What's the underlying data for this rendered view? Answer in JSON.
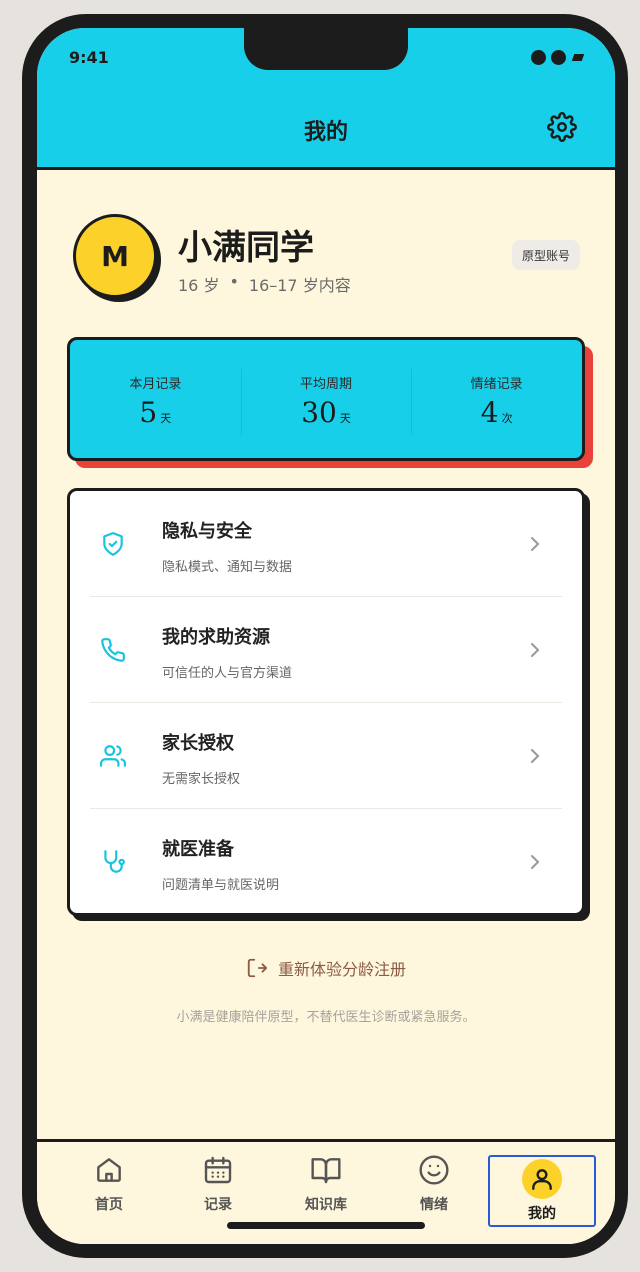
{
  "status": {
    "time": "9:41"
  },
  "header": {
    "title": "我的",
    "settings_icon": "gear-icon"
  },
  "profile": {
    "avatar_initial": "M",
    "name": "小满同学",
    "age": "16 岁",
    "separator": "•",
    "content_range": "16–17 岁内容",
    "badge": "原型账号"
  },
  "stats": [
    {
      "label": "本月记录",
      "value": "5",
      "unit": "天"
    },
    {
      "label": "平均周期",
      "value": "30",
      "unit": "天"
    },
    {
      "label": "情绪记录",
      "value": "4",
      "unit": "次"
    }
  ],
  "menu": [
    {
      "title": "隐私与安全",
      "subtitle": "隐私模式、通知与数据",
      "icon": "shield-check-icon"
    },
    {
      "title": "我的求助资源",
      "subtitle": "可信任的人与官方渠道",
      "icon": "phone-icon"
    },
    {
      "title": "家长授权",
      "subtitle": "无需家长授权",
      "icon": "users-icon"
    },
    {
      "title": "就医准备",
      "subtitle": "问题清单与就医说明",
      "icon": "stethoscope-icon"
    }
  ],
  "reregister": {
    "label": "重新体验分龄注册",
    "icon": "logout-icon"
  },
  "disclaimer": "小满是健康陪伴原型，不替代医生诊断或紧急服务。",
  "tabs": [
    {
      "label": "首页",
      "icon": "home-icon"
    },
    {
      "label": "记录",
      "icon": "calendar-icon"
    },
    {
      "label": "知识库",
      "icon": "book-icon"
    },
    {
      "label": "情绪",
      "icon": "smile-icon"
    },
    {
      "label": "我的",
      "icon": "user-icon",
      "active": true
    }
  ],
  "colors": {
    "accent": "#18cfea",
    "yellow": "#fcd22a",
    "red_shadow": "#e8423a",
    "cream": "#fff7dd",
    "active_tab_border": "#2a5bd7"
  }
}
